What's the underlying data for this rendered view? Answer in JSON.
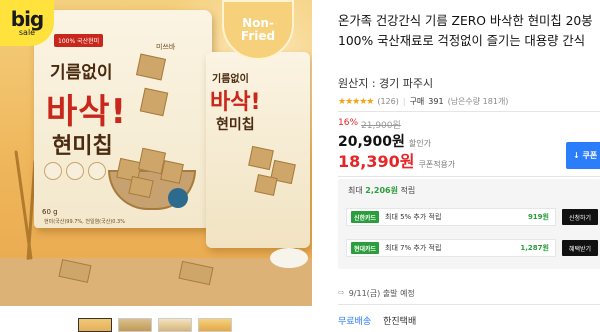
{
  "badge": {
    "big": "big",
    "sale": "sale"
  },
  "product_image": {
    "non_fried": [
      "Non-",
      "Fried"
    ],
    "bag_main": {
      "tag": "100% 국산현미",
      "brand": "미쓰바",
      "line1": "기름없이",
      "line2": "바삭!",
      "line3": "현미칩",
      "net_weight": "60 g",
      "spec": "현미(국산)99.7%, 천일염(국산)0.3%"
    },
    "bag_second": {
      "line1": "기름없이",
      "line2": "바삭!",
      "line3": "현미칩"
    },
    "haccp": "HACCP"
  },
  "thumbnails": [
    "thumb-1",
    "thumb-2",
    "thumb-3",
    "thumb-4"
  ],
  "product": {
    "title": "온가족 건강간식 기름 ZERO 바삭한 현미칩 20봉 100% 국산재료로 걱정없이 즐기는 대용량 간식",
    "origin": "원산지 : 경기 파주시",
    "rating_stars": "★★★★★",
    "review_count": "(126)",
    "purchase_label": "구매",
    "purchase_count": "391",
    "remaining": "(남은수량 181개)"
  },
  "pricing": {
    "discount_pct": "16%",
    "original_price": "21,900원",
    "price_label_1": "20,900원",
    "price_label_1_tag": "할인가",
    "price_label_2": "18,390원",
    "price_label_2_tag": "쿠폰적용가",
    "coupon_button": "↓ 쿠폰"
  },
  "points": {
    "prefix": "최대",
    "amount": "2,206원",
    "suffix": "적립",
    "cards": [
      {
        "logo": "신한카드",
        "desc": "최대 5% 추가 적립",
        "points": "919원",
        "button": "신청하기"
      },
      {
        "logo": "현대카드",
        "desc": "최대 7% 추가 적립",
        "points": "1,287원",
        "button": "혜택받기"
      }
    ]
  },
  "shipping": {
    "icon": "truck-icon",
    "text": "9/11(금) 출발 예정"
  },
  "delivery": {
    "free_label": "무료배송",
    "courier": "한진택배"
  },
  "colors": {
    "accent_red": "#e52528",
    "accent_blue": "#2b7dfa",
    "points_green": "#2a9d3c"
  }
}
